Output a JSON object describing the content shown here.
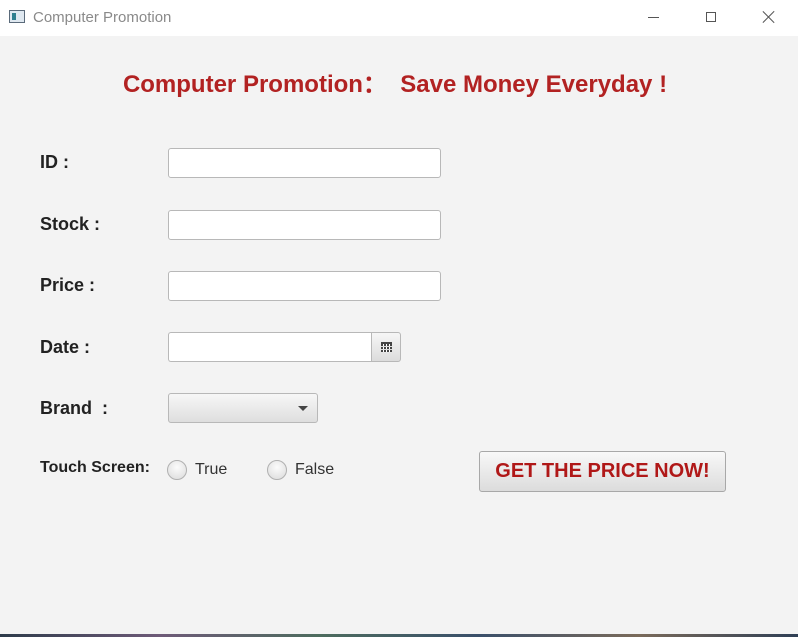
{
  "window": {
    "title": "Computer Promotion",
    "icon": "app-window-icon",
    "controls": {
      "minimize_icon": "minimize-icon",
      "maximize_icon": "maximize-icon",
      "close_icon": "close-icon"
    }
  },
  "header": {
    "headline": "Computer Promotion：  Save Money Everyday !"
  },
  "form": {
    "id_label": "ID :",
    "id_value": "",
    "stock_label": "Stock :",
    "stock_value": "",
    "price_label": "Price :",
    "price_value": "",
    "date_label": "Date :",
    "date_value": "",
    "date_picker_icon": "calendar-icon",
    "brand_label": "Brand  :",
    "brand_selected": "",
    "brand_dropdown_icon": "chevron-down-icon",
    "touch_label": "Touch Screen:",
    "touch_options": [
      {
        "label": "True",
        "selected": false
      },
      {
        "label": "False",
        "selected": false
      }
    ]
  },
  "actions": {
    "get_price_label": "GET THE PRICE NOW!"
  },
  "colors": {
    "accent": "#b22222",
    "background": "#f3f3f3",
    "titlebar": "#ffffff"
  }
}
